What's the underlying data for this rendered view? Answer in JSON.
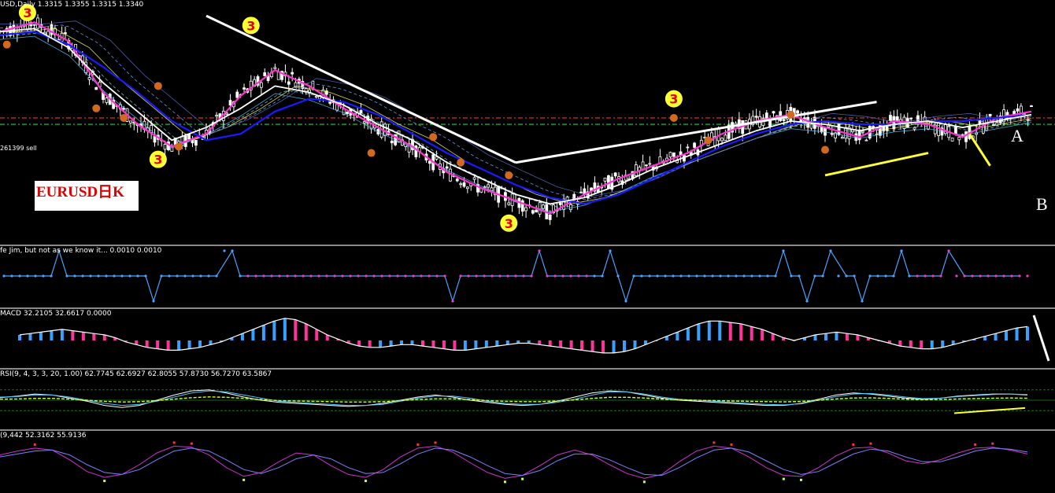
{
  "main": {
    "header": "USD,Daily 1.3315 1.3355 1.3315 1.3340",
    "sell_label": "261399 sell",
    "title_box": "EURUSD日K",
    "point_a": "A",
    "point_b": "B",
    "wave_marker": "3",
    "colors": {
      "bull": "#ffffff",
      "bear": "#ffffff",
      "magenta": "#ff33cc",
      "blue": "#1a1aff",
      "cyan": "#4fc3f7",
      "yellow": "#ffff33",
      "red_level": "#ff2d2d",
      "green_level": "#2ecc40"
    }
  },
  "pane_jim": {
    "header": "fe Jim, but not as we know it... 0.0010 0.0010"
  },
  "pane_macd": {
    "header": "MACD 32.2105 32.6617 0.0000"
  },
  "pane_rsi": {
    "header": "RSI(9, 4, 3, 3, 20, 1.00) 62.7745 62.6927 62.8055 57.8730 56.7270 63.5867"
  },
  "pane_kd": {
    "header": "(9,442 52.3162 55.9136"
  },
  "chart_data": [
    {
      "type": "line",
      "pane": "price",
      "x_index": [
        0,
        10,
        20,
        30,
        40,
        50,
        60,
        70,
        80,
        90,
        100,
        110,
        120,
        130,
        140,
        150,
        160,
        170,
        180,
        190,
        200,
        210,
        220,
        230,
        240,
        250,
        260,
        270,
        280,
        290,
        300
      ],
      "series": [
        {
          "values": [
            1.334,
            1.337,
            1.331,
            1.315,
            1.305,
            1.298,
            1.302,
            1.314,
            1.322,
            1.317,
            1.31,
            1.304,
            1.298,
            1.29,
            1.285,
            1.281,
            1.277,
            1.283,
            1.288,
            1.292,
            1.296,
            1.302,
            1.306,
            1.308,
            1.304,
            1.301,
            1.306,
            1.305,
            1.301,
            1.307,
            1.309
          ]
        },
        {
          "values": [
            1.334,
            1.335,
            1.329,
            1.318,
            1.309,
            1.3,
            1.304,
            1.31,
            1.317,
            1.315,
            1.311,
            1.305,
            1.3,
            1.293,
            1.288,
            1.283,
            1.28,
            1.282,
            1.286,
            1.291,
            1.295,
            1.299,
            1.303,
            1.306,
            1.305,
            1.303,
            1.305,
            1.306,
            1.304,
            1.306,
            1.308
          ]
        },
        {
          "values": [
            1.333,
            1.334,
            1.33,
            1.323,
            1.315,
            1.306,
            1.3,
            1.302,
            1.309,
            1.313,
            1.312,
            1.308,
            1.302,
            1.296,
            1.291,
            1.286,
            1.282,
            1.28,
            1.283,
            1.288,
            1.293,
            1.298,
            1.302,
            1.305,
            1.306,
            1.305,
            1.305,
            1.306,
            1.306,
            1.307,
            1.308
          ]
        }
      ],
      "levels": [
        1.307,
        1.305
      ],
      "trendlines": [
        {
          "from": [
            60,
            1.339
          ],
          "to": [
            150,
            1.293
          ]
        },
        {
          "from": [
            150,
            1.293
          ],
          "to": [
            255,
            1.312
          ]
        },
        {
          "from": [
            240,
            1.289
          ],
          "to": [
            270,
            1.296
          ]
        }
      ],
      "wave3_markers": [
        [
          8,
          1.34
        ],
        [
          46,
          1.294
        ],
        [
          73,
          1.336
        ],
        [
          148,
          1.274
        ],
        [
          196,
          1.313
        ]
      ],
      "annotations": [
        "A",
        "B"
      ]
    },
    {
      "type": "line",
      "pane": "jim",
      "x_index": [
        0,
        12,
        14,
        16,
        36,
        38,
        40,
        54,
        58,
        60,
        112,
        114,
        116,
        118,
        134,
        136,
        138,
        140,
        150,
        152,
        154,
        156,
        158,
        160,
        196,
        198,
        200,
        202,
        204,
        206,
        208,
        210,
        214,
        216,
        218,
        220,
        224,
        226,
        228,
        230,
        232,
        234,
        236,
        238,
        240,
        244,
        246,
        248,
        250,
        252,
        254,
        256,
        258
      ],
      "values": [
        0,
        0,
        1,
        0,
        0,
        -1,
        0,
        0,
        1,
        0,
        0,
        -1,
        0,
        0,
        0,
        1,
        0,
        0,
        0,
        0,
        1,
        0,
        -1,
        0,
        0,
        1,
        0,
        0,
        -1,
        0,
        0,
        1,
        0,
        0,
        -1,
        0,
        0,
        0,
        1,
        0,
        0,
        0,
        0,
        0,
        1,
        0,
        0,
        0,
        0,
        0,
        0,
        0,
        0
      ],
      "ylim": [
        -1,
        1
      ]
    },
    {
      "type": "bar",
      "pane": "macd",
      "values": [
        8,
        10,
        12,
        14,
        16,
        14,
        12,
        10,
        8,
        4,
        -2,
        -6,
        -10,
        -12,
        -14,
        -14,
        -12,
        -10,
        -6,
        -2,
        4,
        10,
        16,
        22,
        28,
        32,
        30,
        24,
        16,
        8,
        2,
        -4,
        -8,
        -10,
        -10,
        -8,
        -6,
        -6,
        -8,
        -10,
        -12,
        -14,
        -14,
        -12,
        -10,
        -8,
        -6,
        -4,
        -4,
        -6,
        -8,
        -10,
        -12,
        -14,
        -16,
        -18,
        -18,
        -16,
        -12,
        -6,
        0,
        6,
        12,
        18,
        24,
        28,
        28,
        26,
        24,
        20,
        16,
        10,
        4,
        0,
        4,
        8,
        10,
        12,
        10,
        8,
        4,
        0,
        -4,
        -8,
        -10,
        -12,
        -12,
        -10,
        -6,
        -2,
        2,
        6,
        10,
        14,
        18,
        20
      ],
      "ylim": [
        -30,
        34
      ]
    },
    {
      "type": "line",
      "pane": "rsi",
      "series": [
        {
          "values": [
            55,
            58,
            62,
            60,
            54,
            48,
            40,
            36,
            40,
            50,
            60,
            68,
            70,
            64,
            56,
            50,
            46,
            44,
            42,
            40,
            38,
            40,
            44,
            50,
            56,
            60,
            56,
            50,
            46,
            42,
            40,
            42,
            48,
            56,
            64,
            68,
            66,
            60,
            54,
            50,
            48,
            46,
            44,
            42,
            40,
            40,
            44,
            52,
            60,
            64,
            62,
            58,
            54,
            52,
            54,
            58,
            60,
            62,
            62,
            60
          ]
        },
        {
          "values": [
            56,
            57,
            60,
            60,
            56,
            50,
            44,
            40,
            42,
            48,
            56,
            64,
            68,
            66,
            60,
            54,
            48,
            46,
            44,
            42,
            40,
            40,
            42,
            48,
            54,
            58,
            58,
            54,
            48,
            44,
            42,
            42,
            46,
            52,
            60,
            66,
            66,
            62,
            56,
            52,
            50,
            48,
            46,
            44,
            42,
            41,
            43,
            50,
            57,
            62,
            63,
            60,
            56,
            53,
            54,
            57,
            59,
            61,
            62,
            61
          ]
        }
      ],
      "levels": [
        70,
        50,
        30
      ],
      "ylim": [
        0,
        100
      ]
    },
    {
      "type": "line",
      "pane": "kd",
      "series": [
        {
          "values": [
            70,
            78,
            84,
            80,
            60,
            36,
            24,
            30,
            50,
            74,
            88,
            86,
            70,
            44,
            26,
            34,
            56,
            74,
            70,
            48,
            30,
            24,
            40,
            66,
            84,
            88,
            76,
            54,
            34,
            22,
            28,
            48,
            70,
            80,
            70,
            50,
            32,
            22,
            30,
            56,
            78,
            88,
            84,
            66,
            44,
            28,
            26,
            44,
            68,
            84,
            86,
            74,
            58,
            52,
            60,
            74,
            84,
            86,
            80,
            72
          ]
        },
        {
          "values": [
            66,
            72,
            78,
            80,
            70,
            50,
            34,
            30,
            40,
            60,
            78,
            84,
            78,
            60,
            40,
            32,
            44,
            62,
            70,
            62,
            44,
            32,
            34,
            52,
            72,
            84,
            80,
            66,
            48,
            32,
            28,
            38,
            58,
            72,
            72,
            60,
            44,
            30,
            28,
            44,
            64,
            80,
            84,
            76,
            58,
            40,
            30,
            36,
            54,
            72,
            82,
            78,
            66,
            56,
            56,
            66,
            78,
            84,
            82,
            76
          ]
        }
      ],
      "ylim": [
        0,
        100
      ]
    }
  ]
}
